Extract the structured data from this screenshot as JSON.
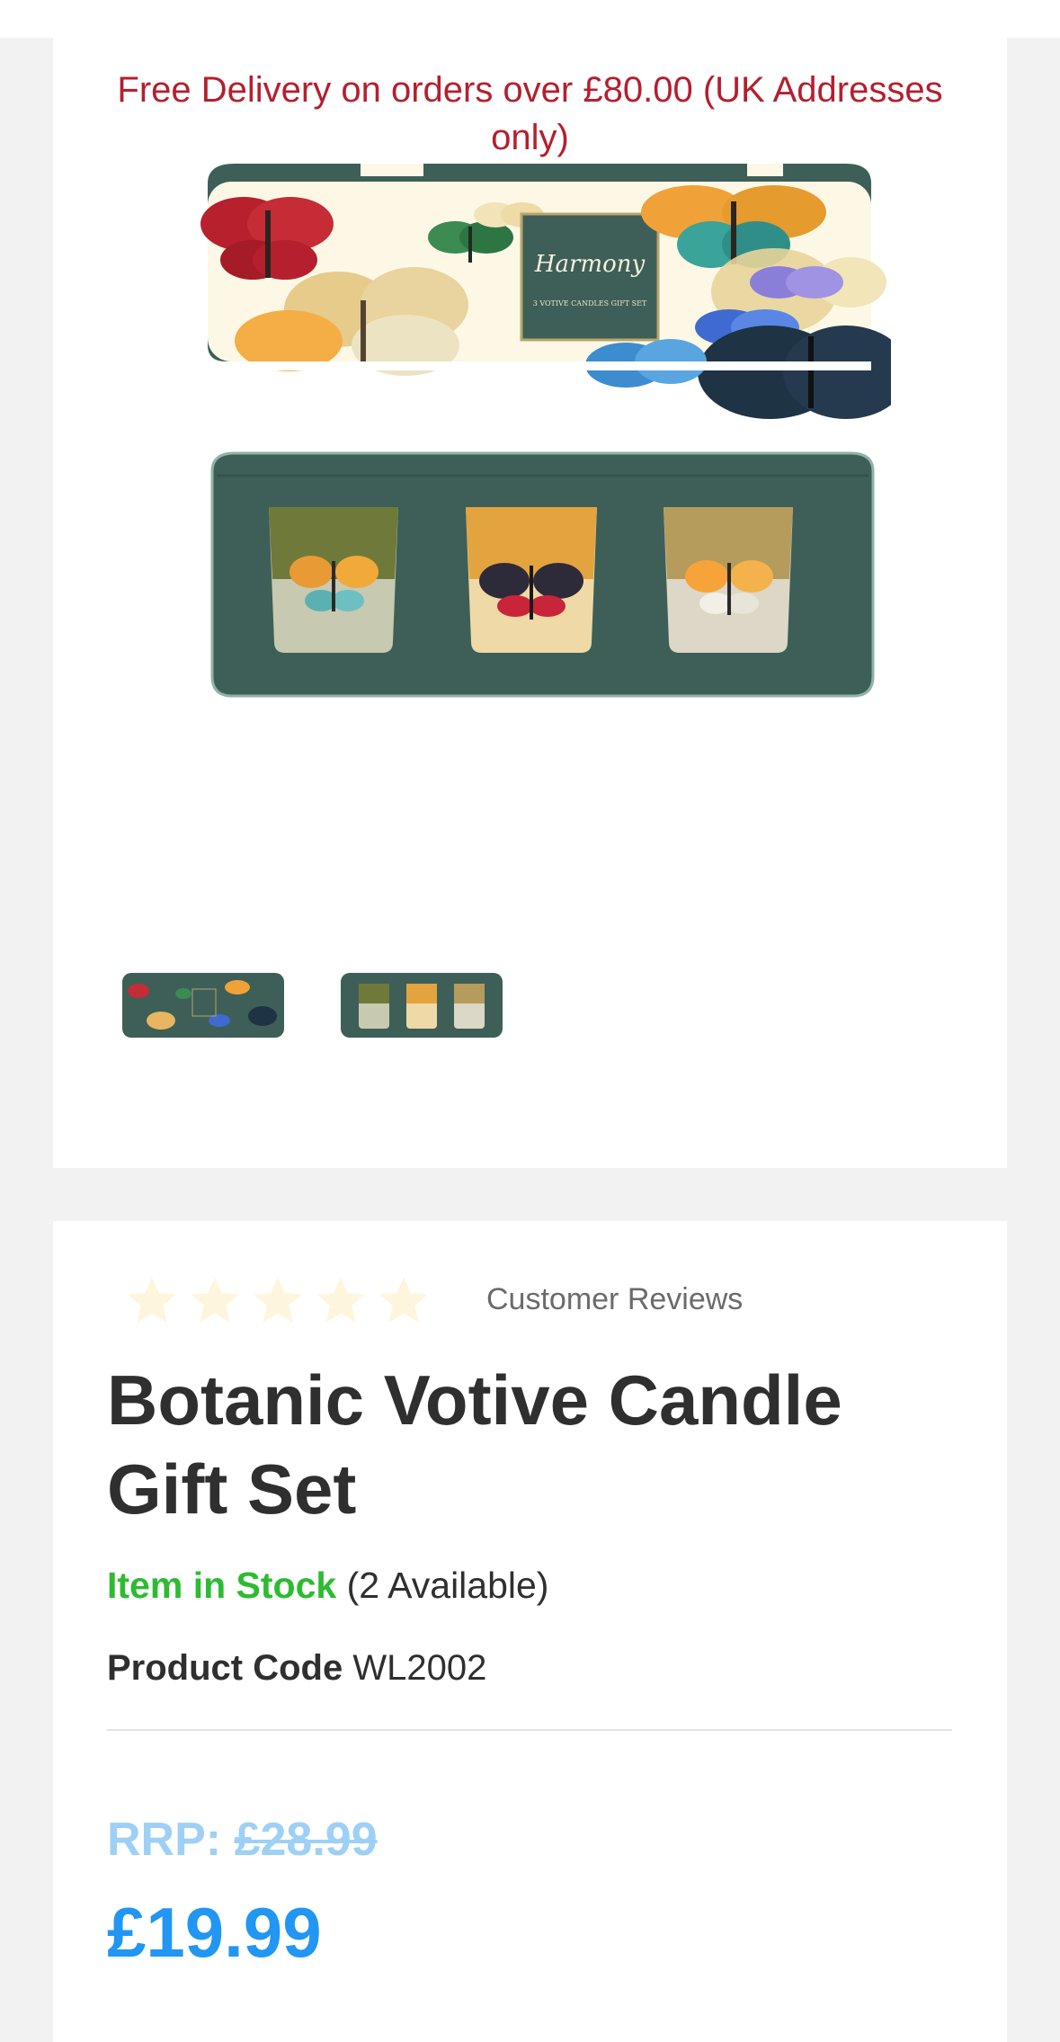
{
  "banner": {
    "delivery_text": "Free Delivery on orders over £80.00 (UK Addresses only)"
  },
  "gallery": {
    "main_image": {
      "lid_title": "Harmony",
      "lid_subtitle": "3 VOTIVE CANDLES GIFT SET"
    },
    "thumbnails": [
      {
        "name": "thumbnail-lid"
      },
      {
        "name": "thumbnail-candles"
      }
    ]
  },
  "product": {
    "rating": {
      "stars_total": 5,
      "stars_filled": 0
    },
    "reviews_label": "Customer Reviews",
    "title": "Botanic Votive Candle Gift Set",
    "stock_status": "Item in Stock",
    "stock_available": "(2 Available)",
    "code_label": "Product Code",
    "code_value": "WL2002",
    "rrp_label": "RRP:",
    "rrp_value": "£28.99",
    "price": "£19.99"
  },
  "colors": {
    "banner_red": "#b51f2e",
    "stock_green": "#2dbb32",
    "price_blue": "#2196f3",
    "rrp_light_blue": "#9ed0f6",
    "star_empty": "#fdf6dc",
    "tin_green": "#3e5f57"
  }
}
